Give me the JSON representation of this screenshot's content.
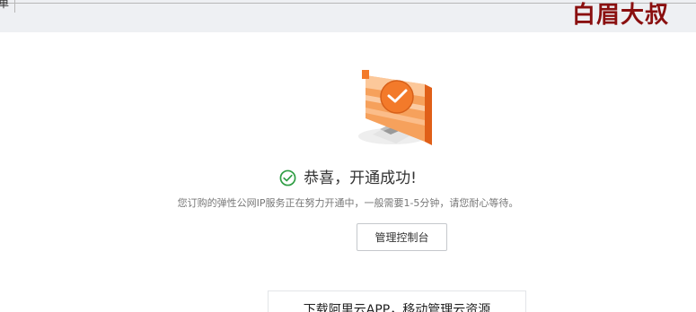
{
  "header": {
    "breadcrumb_tail": "单",
    "watermark": "白眉大叔"
  },
  "result": {
    "title": "恭喜，开通成功!",
    "description": "您订购的弹性公网IP服务正在努力开通中，一般需要1-5分钟，请您耐心等待。",
    "console_button": "管理控制台",
    "app_promo": "下载阿里云APP，移动管理云资源"
  },
  "colors": {
    "header_bg": "#eef0f3",
    "accent_orange": "#f37a2a",
    "success_green": "#2f9e44",
    "watermark": "#8a0f0f"
  },
  "icons": {
    "status": "check-circle-icon",
    "illustration": "monitor-success-illustration"
  }
}
